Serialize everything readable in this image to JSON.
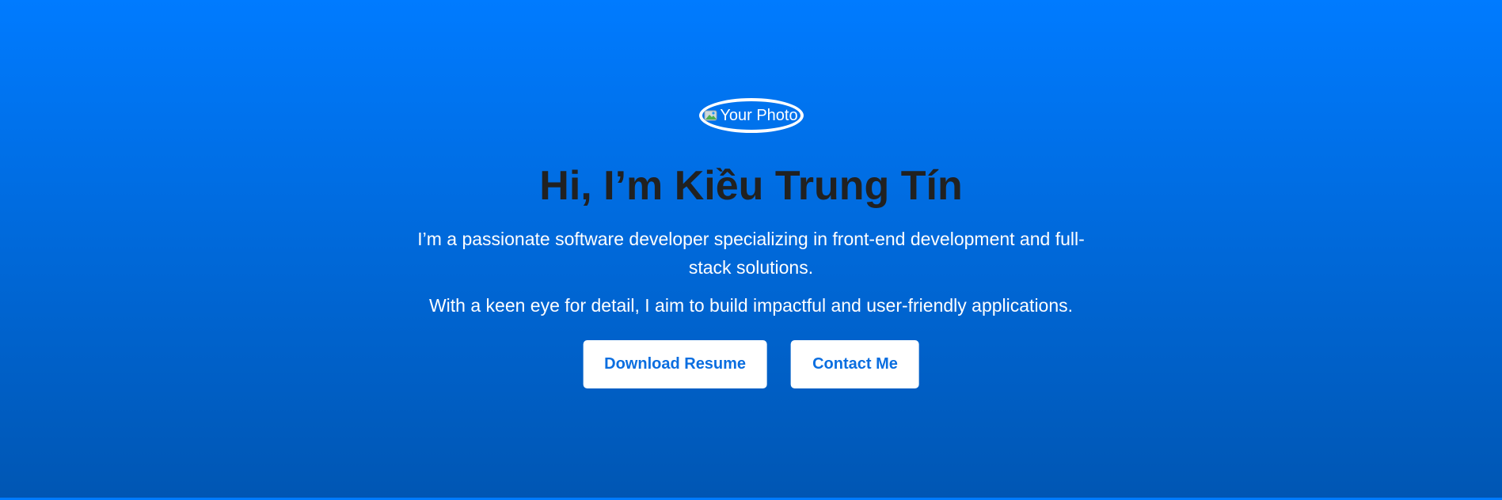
{
  "hero": {
    "photo_alt": "Your Photo",
    "title": "Hi, I’m Kiều Trung Tín",
    "description_1": "I’m a passionate software developer specializing in front-end development and full-stack solutions.",
    "description_2": "With a keen eye for detail, I aim to build impactful and user-friendly applications.",
    "buttons": {
      "download_resume": "Download Resume",
      "contact_me": "Contact Me"
    }
  },
  "colors": {
    "gradient_top": "#007bff",
    "gradient_bottom": "#0056b3",
    "title_text": "#212121",
    "button_text": "#0a6ee0",
    "button_bg": "#ffffff"
  },
  "icons": {
    "photo_placeholder": "broken-image-icon"
  }
}
